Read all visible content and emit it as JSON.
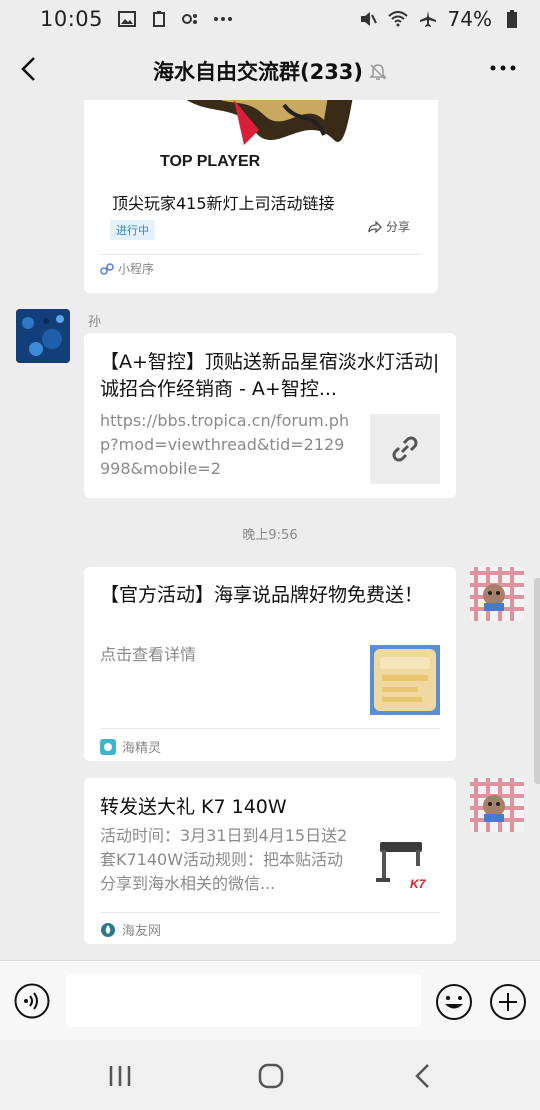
{
  "status_bar": {
    "time": "10:05",
    "battery": "74%"
  },
  "header": {
    "title": "海水自由交流群(233)"
  },
  "messages": {
    "mini_program": {
      "banner_text": "TOP PLAYER",
      "title": "顶尖玩家415新灯上司活动链接",
      "badge": "进行中",
      "share_label": "分享",
      "footer_label": "小程序"
    },
    "link": {
      "sender": "孙",
      "title": "【A+智控】顶贴送新品星宿淡水灯活动|诚招合作经销商 - A+智控...",
      "description": "https://bbs.tropica.cn/forum.php?mod=viewthread&tid=2129998&mobile=2"
    },
    "time_label": "晚上9:56",
    "promo": {
      "title": "【官方活动】海享说品牌好物免费送！",
      "subtitle": "点击查看详情",
      "source": "海精灵"
    },
    "gift": {
      "title": "转发送大礼 K7 140W",
      "description": "活动时间：3月31日到4月15日送2套K7140W活动规则：把本贴活动分享到海水相关的微信...",
      "source": "海友网"
    }
  },
  "colors": {
    "background": "#ededed",
    "card": "#ffffff",
    "badge_blue": "#2b86c6"
  },
  "icons": {
    "back": "chevron-left-icon",
    "mute": "bell-off-icon",
    "more": "more-icon",
    "link": "link-icon",
    "voice": "voice-icon",
    "emoji": "emoji-icon",
    "plus": "plus-icon"
  }
}
